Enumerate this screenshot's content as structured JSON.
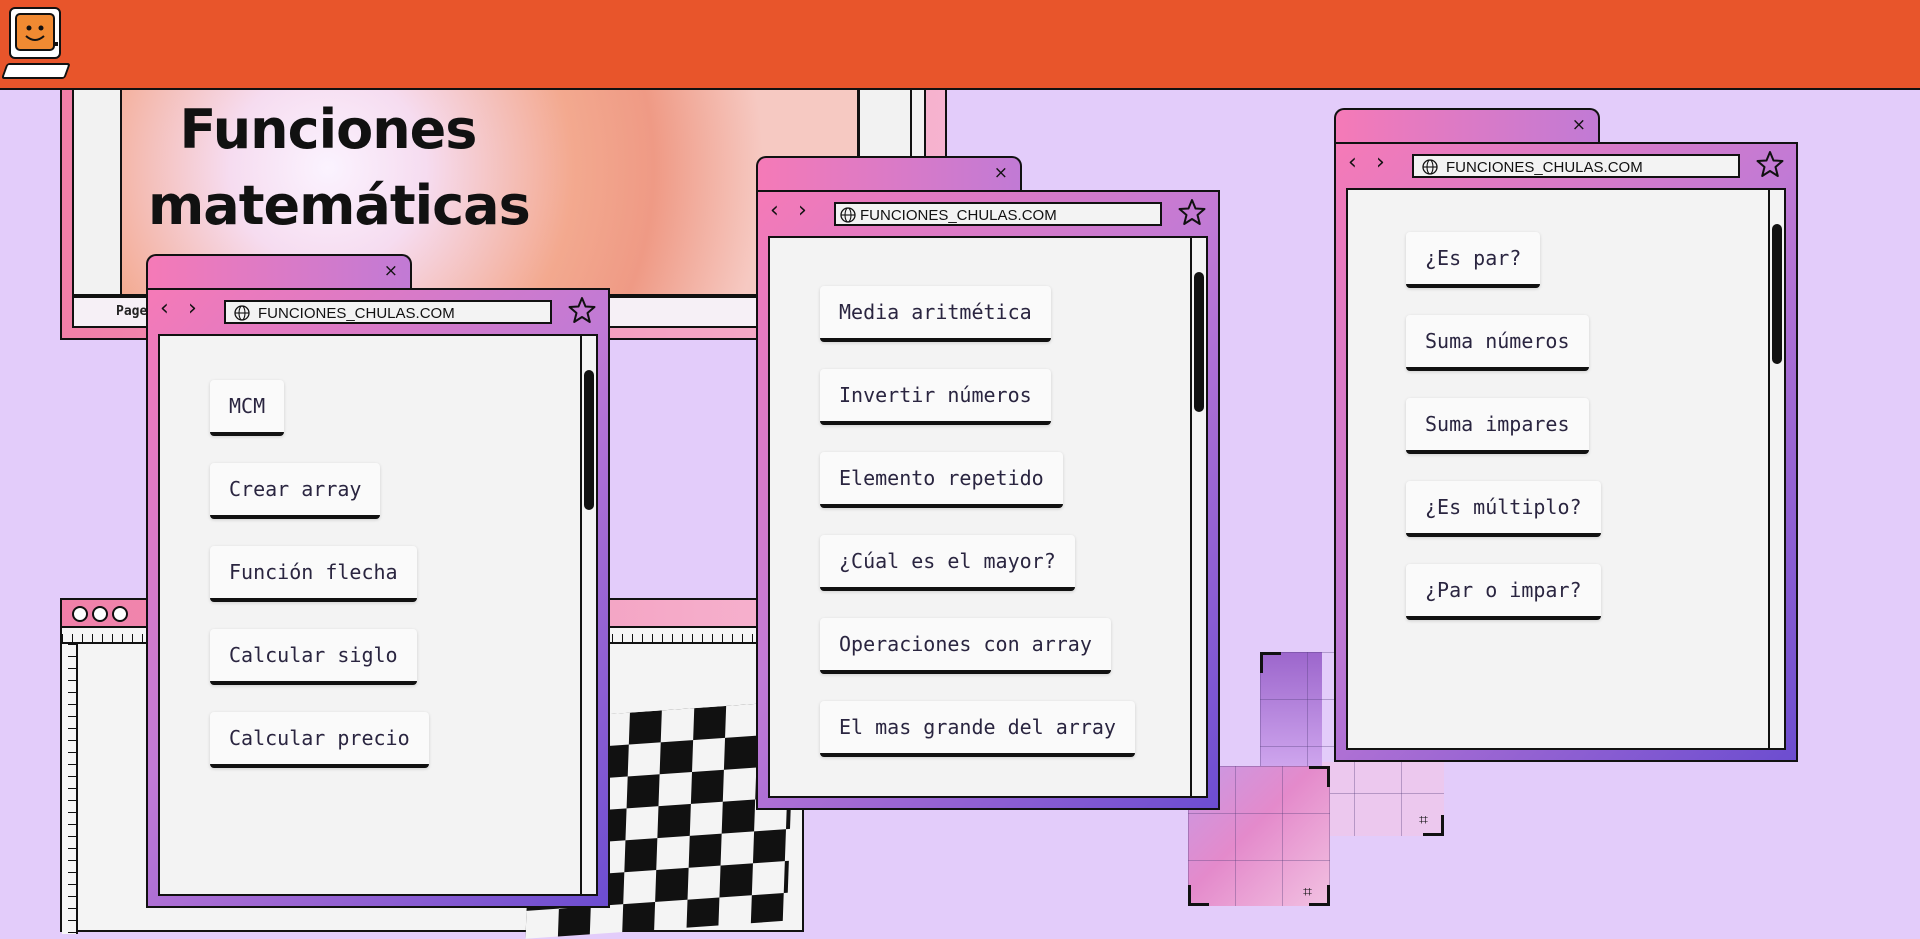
{
  "page": {
    "title": "Funciones matemáticas",
    "title_line1": "Funciones",
    "title_line2": "matemáticas",
    "page_label": "Page"
  },
  "colors": {
    "topbar": "#e8552b",
    "background": "#e3ccfa",
    "window_gradient_start": "#f57ab7",
    "window_gradient_end": "#6c4dd0"
  },
  "icons": {
    "logo": "retro-computer-smiley-icon",
    "back": "chevron-left-icon",
    "forward": "chevron-right-icon",
    "globe": "globe-icon",
    "bookmark": "star-icon",
    "close": "close-icon",
    "crop": "crop-icon"
  },
  "windows": [
    {
      "url": "FUNCIONES_CHULAS.COM",
      "close": "×",
      "buttons": [
        "MCM",
        "Crear array",
        "Función flecha",
        "Calcular siglo",
        "Calcular precio"
      ]
    },
    {
      "url": "FUNCIONES_CHULAS.COM",
      "close": "×",
      "buttons": [
        "Media aritmética",
        "Invertir números",
        "Elemento repetido",
        "¿Cúal es el mayor?",
        "Operaciones con array",
        "El mas grande del array"
      ]
    },
    {
      "url": "FUNCIONES_CHULAS.COM",
      "close": "×",
      "buttons": [
        "¿Es par?",
        "Suma números",
        "Suma impares",
        "¿Es múltiplo?",
        "¿Par o impar?"
      ]
    }
  ]
}
